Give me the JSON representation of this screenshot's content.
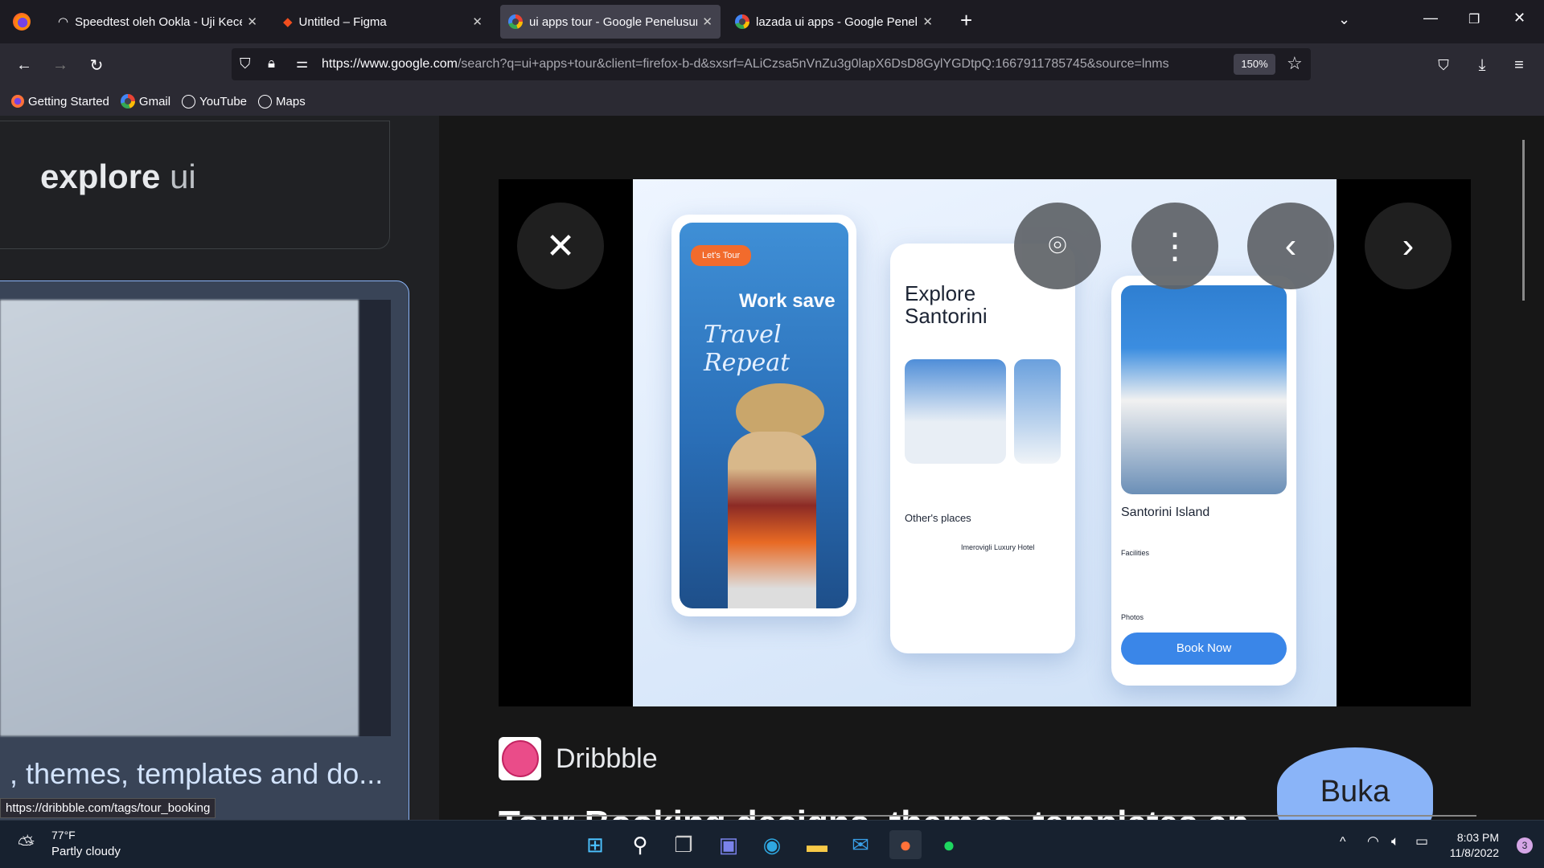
{
  "browser": {
    "tabs": [
      {
        "title": "Speedtest oleh Ookla - Uji Kecepatan",
        "active": false
      },
      {
        "title": "Untitled – Figma",
        "active": false
      },
      {
        "title": "ui apps tour - Google Penelusuran",
        "active": true
      },
      {
        "title": "lazada ui apps - Google Penelusuran",
        "active": false
      }
    ],
    "new_tab": "+",
    "url_domain": "https://www.google.com",
    "url_rest": "/search?q=ui+apps+tour&client=firefox-b-d&sxsrf=ALiCzsa5nVnZu3g0lapX6DsD8GylYGDtpQ:1667911785745&source=lnms",
    "zoom": "150%",
    "bookmarks": [
      "Getting Started",
      "Gmail",
      "YouTube",
      "Maps"
    ]
  },
  "left": {
    "explore_bold": "explore",
    "explore_light": " ui",
    "result_title": ", themes, templates and do...",
    "status_url": "https://dribbble.com/tags/tour_booking"
  },
  "viewer": {
    "mock": {
      "badge": "Let's Tour",
      "headline": "Work save",
      "script": "Travel Repeat",
      "explore": "Explore Santorini",
      "others": "Other's places",
      "hotel": "Imerovigli Luxury Hotel",
      "island": "Santorini Island",
      "facilities": "Facilities",
      "photos": "Photos",
      "book": "Book Now"
    },
    "source": "Dribbble",
    "title": "Tour Booking designs, themes, templates an",
    "open_button": "Buka"
  },
  "taskbar": {
    "weather_temp": "77°F",
    "weather_desc": "Partly cloudy",
    "time": "8:03 PM",
    "date": "11/8/2022",
    "notifications": "3"
  }
}
